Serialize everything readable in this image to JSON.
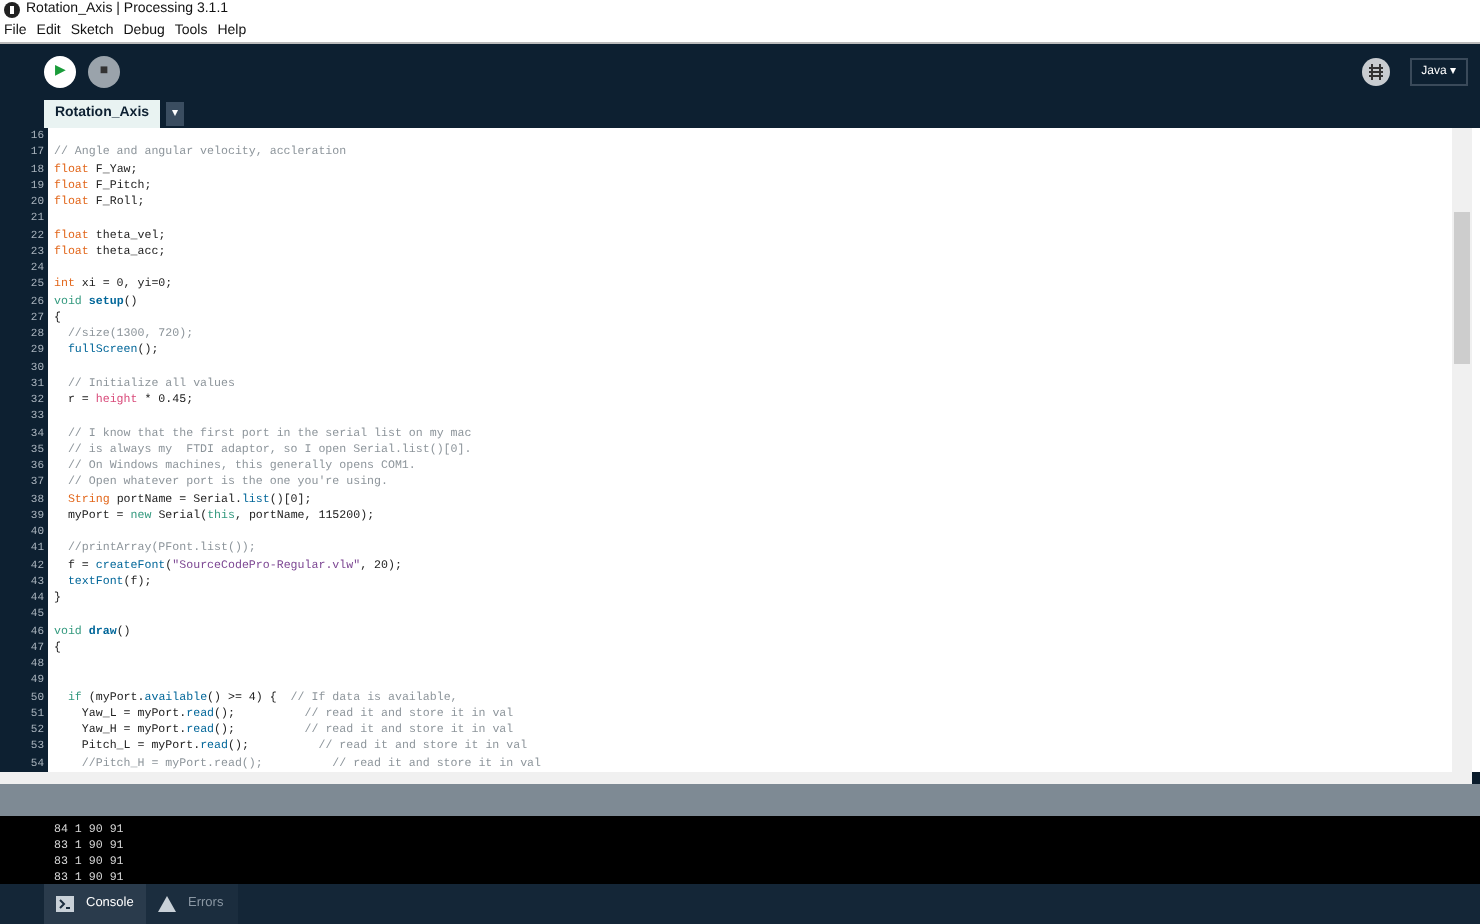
{
  "window": {
    "title": "Rotation_Axis | Processing 3.1.1"
  },
  "menu": [
    "File",
    "Edit",
    "Sketch",
    "Debug",
    "Tools",
    "Help"
  ],
  "toolbar": {
    "run": "▶",
    "stop": "■",
    "mode": "Java ▾"
  },
  "tabs": [
    {
      "label": "Rotation_Axis",
      "selected": true
    }
  ],
  "tab_menu": "▾",
  "editor": {
    "lines": [
      {
        "number": "16"
      },
      {
        "number": "17",
        "parts": [
          {
            "text": "// Angle and angular velocity, accleration",
            "kind": "comment"
          }
        ]
      },
      {
        "number": "18",
        "parts": [
          {
            "text": "float",
            "kind": "type"
          },
          {
            "text": " F_Yaw;",
            "kind": "plain"
          }
        ]
      },
      {
        "number": "19",
        "parts": [
          {
            "text": "float",
            "kind": "type"
          },
          {
            "text": " F_Pitch;",
            "kind": "plain"
          }
        ]
      },
      {
        "number": "20",
        "parts": [
          {
            "text": "float",
            "kind": "type"
          },
          {
            "text": " F_Roll;",
            "kind": "plain"
          }
        ]
      },
      {
        "number": "21"
      },
      {
        "number": "22",
        "parts": [
          {
            "text": "float",
            "kind": "type"
          },
          {
            "text": " theta_vel;",
            "kind": "plain"
          }
        ]
      },
      {
        "number": "23",
        "parts": [
          {
            "text": "float",
            "kind": "type"
          },
          {
            "text": " theta_acc;",
            "kind": "plain"
          }
        ]
      },
      {
        "number": "24"
      },
      {
        "number": "25",
        "parts": [
          {
            "text": "int",
            "kind": "type"
          },
          {
            "text": " xi = 0, yi=0;",
            "kind": "plain"
          }
        ]
      },
      {
        "number": "26",
        "parts": [
          {
            "text": "void ",
            "kind": "keyword"
          },
          {
            "text": "setup",
            "kind": "definition"
          },
          {
            "text": "()",
            "kind": "plain"
          }
        ]
      },
      {
        "number": "27",
        "parts": [
          {
            "text": "{",
            "kind": "plain"
          }
        ]
      },
      {
        "number": "28",
        "parts": [
          {
            "text": "  //size(1300, 720);",
            "kind": "comment"
          }
        ]
      },
      {
        "number": "29",
        "parts": [
          {
            "text": "  fullScreen",
            "kind": "function"
          },
          {
            "text": "();",
            "kind": "plain"
          }
        ]
      },
      {
        "number": "30"
      },
      {
        "number": "31",
        "parts": [
          {
            "text": "  // Initialize all values",
            "kind": "comment"
          }
        ]
      },
      {
        "number": "32",
        "parts": [
          {
            "text": "  r = ",
            "kind": "plain"
          },
          {
            "text": "height",
            "kind": "constant"
          },
          {
            "text": " * 0.45;",
            "kind": "plain"
          }
        ]
      },
      {
        "number": "33"
      },
      {
        "number": "34",
        "parts": [
          {
            "text": "  // I know that the first port in the serial list on my mac",
            "kind": "comment"
          }
        ]
      },
      {
        "number": "35",
        "parts": [
          {
            "text": "  // is always my  FTDI adaptor, so I open Serial.list()[0].",
            "kind": "comment"
          }
        ]
      },
      {
        "number": "36",
        "parts": [
          {
            "text": "  // On Windows machines, this generally opens COM1.",
            "kind": "comment"
          }
        ]
      },
      {
        "number": "37",
        "parts": [
          {
            "text": "  // Open whatever port is the one you're using.",
            "kind": "comment"
          }
        ]
      },
      {
        "number": "38",
        "parts": [
          {
            "text": "  String",
            "kind": "type"
          },
          {
            "text": " portName = Serial.",
            "kind": "plain"
          },
          {
            "text": "list",
            "kind": "function"
          },
          {
            "text": "()[0];",
            "kind": "plain"
          }
        ]
      },
      {
        "number": "39",
        "parts": [
          {
            "text": "  myPort = ",
            "kind": "plain"
          },
          {
            "text": "new",
            "kind": "keyword"
          },
          {
            "text": " Serial(",
            "kind": "plain"
          },
          {
            "text": "this",
            "kind": "keyword"
          },
          {
            "text": ", portName, 115200);",
            "kind": "plain"
          }
        ]
      },
      {
        "number": "40"
      },
      {
        "number": "41",
        "parts": [
          {
            "text": "  //printArray(PFont.list());",
            "kind": "comment"
          }
        ]
      },
      {
        "number": "42",
        "parts": [
          {
            "text": "  f = ",
            "kind": "plain"
          },
          {
            "text": "createFont",
            "kind": "function"
          },
          {
            "text": "(",
            "kind": "plain"
          },
          {
            "text": "\"SourceCodePro-Regular.vlw\"",
            "kind": "string"
          },
          {
            "text": ", 20);",
            "kind": "plain"
          }
        ]
      },
      {
        "number": "43",
        "parts": [
          {
            "text": "  textFont",
            "kind": "function"
          },
          {
            "text": "(f);",
            "kind": "plain"
          }
        ]
      },
      {
        "number": "44",
        "parts": [
          {
            "text": "}",
            "kind": "plain"
          }
        ]
      },
      {
        "number": "45"
      },
      {
        "number": "46",
        "parts": [
          {
            "text": "void ",
            "kind": "keyword"
          },
          {
            "text": "draw",
            "kind": "definition"
          },
          {
            "text": "()",
            "kind": "plain"
          }
        ]
      },
      {
        "number": "47",
        "parts": [
          {
            "text": "{",
            "kind": "plain"
          }
        ]
      },
      {
        "number": "48"
      },
      {
        "number": "49"
      },
      {
        "number": "50",
        "parts": [
          {
            "text": "  if",
            "kind": "keyword"
          },
          {
            "text": " (myPort.",
            "kind": "plain"
          },
          {
            "text": "available",
            "kind": "function"
          },
          {
            "text": "() >= 4) {  ",
            "kind": "plain"
          },
          {
            "text": "// If data is available,",
            "kind": "comment"
          }
        ]
      },
      {
        "number": "51",
        "parts": [
          {
            "text": "    Yaw_L = myPort.",
            "kind": "plain"
          },
          {
            "text": "read",
            "kind": "function"
          },
          {
            "text": "();          ",
            "kind": "plain"
          },
          {
            "text": "// read it and store it in val",
            "kind": "comment"
          }
        ]
      },
      {
        "number": "52",
        "parts": [
          {
            "text": "    Yaw_H = myPort.",
            "kind": "plain"
          },
          {
            "text": "read",
            "kind": "function"
          },
          {
            "text": "();          ",
            "kind": "plain"
          },
          {
            "text": "// read it and store it in val",
            "kind": "comment"
          }
        ]
      },
      {
        "number": "53",
        "parts": [
          {
            "text": "    Pitch_L = myPort.",
            "kind": "plain"
          },
          {
            "text": "read",
            "kind": "function"
          },
          {
            "text": "();          ",
            "kind": "plain"
          },
          {
            "text": "// read it and store it in val",
            "kind": "comment"
          }
        ]
      },
      {
        "number": "54",
        "parts": [
          {
            "text": "    //Pitch_H = myPort.read();          // read it and store it in val",
            "kind": "comment"
          }
        ]
      }
    ]
  },
  "console": {
    "lines": [
      "84 1 90 91",
      "83 1 90 91",
      "83 1 90 91",
      "83 1 90 91"
    ]
  },
  "bottom_tabs": [
    {
      "label": "Console",
      "selected": true
    },
    {
      "label": "Errors",
      "selected": false
    }
  ]
}
